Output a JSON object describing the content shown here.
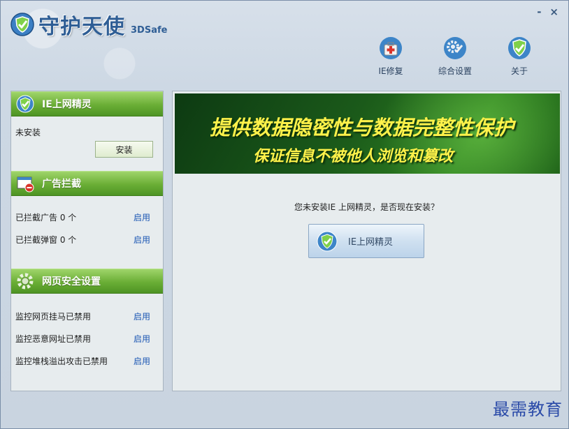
{
  "app": {
    "title": "守护天使",
    "subtitle": "3DSafe"
  },
  "window": {
    "minimize": "-",
    "close": "×"
  },
  "toolbar": [
    {
      "label": "IE修复",
      "icon": "first-aid-kit-icon"
    },
    {
      "label": "综合设置",
      "icon": "gear-icon"
    },
    {
      "label": "关于",
      "icon": "shield-check-icon"
    }
  ],
  "sidebar": {
    "ie_section": {
      "title": "IE上网精灵",
      "status": "未安装",
      "install_label": "安装"
    },
    "ad_section": {
      "title": "广告拦截",
      "rows": [
        {
          "label": "已拦截广告 0 个",
          "action": "启用"
        },
        {
          "label": "已拦截弹窗 0 个",
          "action": "启用"
        }
      ]
    },
    "security_section": {
      "title": "网页安全设置",
      "rows": [
        {
          "label": "监控网页挂马已禁用",
          "action": "启用"
        },
        {
          "label": "监控恶意网址已禁用",
          "action": "启用"
        },
        {
          "label": "监控堆栈溢出攻击已禁用",
          "action": "启用"
        }
      ]
    }
  },
  "main": {
    "banner_line1": "提供数据隐密性与数据完整性保护",
    "banner_line2": "保证信息不被他人浏览和篡改",
    "prompt": "您未安装IE 上网精灵，是否现在安装？",
    "ie_button_label": "IE上网精灵"
  },
  "watermark": "最需教育",
  "colors": {
    "accent_green": "#6aae35",
    "banner_text": "#fff24a",
    "link": "#1e58b4"
  }
}
